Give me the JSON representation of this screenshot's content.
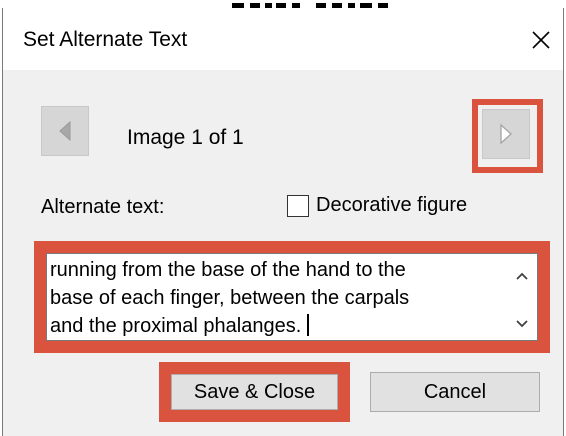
{
  "dialog": {
    "title": "Set Alternate Text",
    "close_label": "Close"
  },
  "navigation": {
    "image_counter": "Image 1 of 1",
    "prev_icon": "triangle-left-icon",
    "next_icon": "triangle-right-icon"
  },
  "alt_text": {
    "label": "Alternate text:",
    "decorative_label": "Decorative figure",
    "decorative_checked": false,
    "value": "running from the base of the hand to the\nbase of each finger, between the carpals\nand the proximal phalanges."
  },
  "buttons": {
    "save_label": "Save & Close",
    "cancel_label": "Cancel"
  },
  "colors": {
    "highlight": "#d9533f",
    "dialog_background": "#f0f0f0",
    "button_background": "#e1e1e1"
  }
}
